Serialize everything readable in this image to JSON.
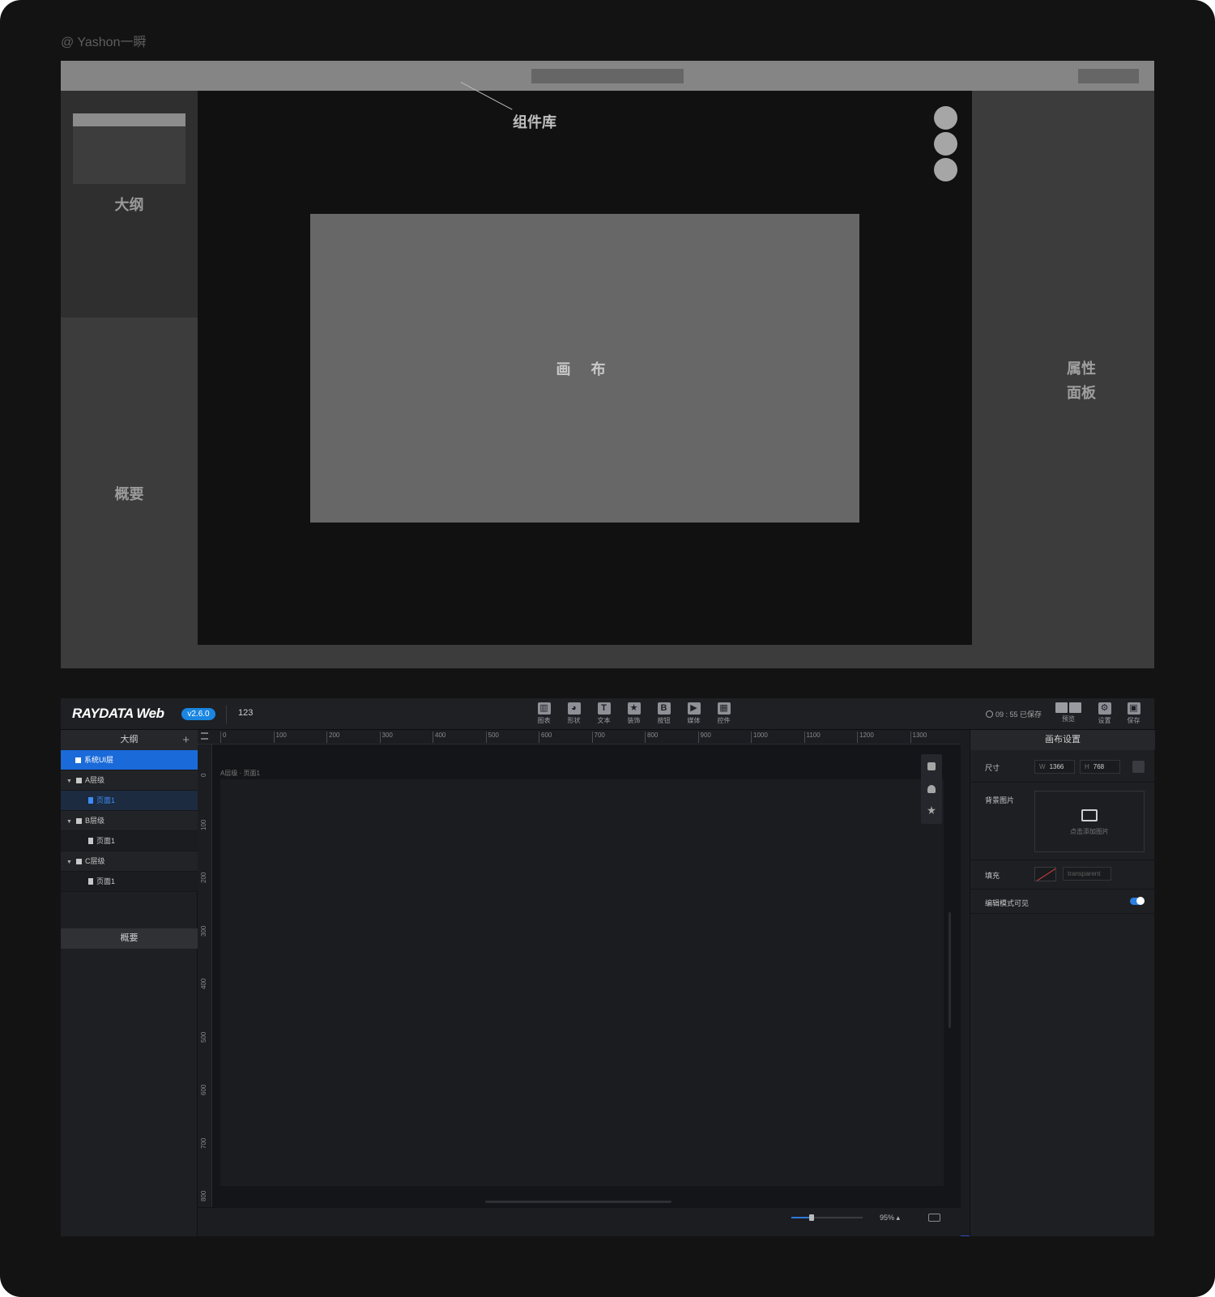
{
  "credit": "@ Yashon一瞬",
  "wireframe": {
    "outline_label": "大纲",
    "summary_label": "概要",
    "canvas_label": "画 布",
    "component_library_label": "组件库",
    "properties_label_1": "属性",
    "properties_label_2": "面板"
  },
  "app": {
    "logo": "RAYDATA Web",
    "version": "v2.6.0",
    "project_name": "123",
    "toolbar": [
      {
        "label": "图表",
        "icon": "chart-icon",
        "glyph": "▥"
      },
      {
        "label": "形状",
        "icon": "shape-icon",
        "glyph": "◕"
      },
      {
        "label": "文本",
        "icon": "text-icon",
        "glyph": "T"
      },
      {
        "label": "装饰",
        "icon": "decoration-star-icon",
        "glyph": "★"
      },
      {
        "label": "按钮",
        "icon": "button-b-icon",
        "glyph": "B"
      },
      {
        "label": "媒体",
        "icon": "media-play-icon",
        "glyph": "▶"
      },
      {
        "label": "控件",
        "icon": "widget-grid-icon",
        "glyph": "▦"
      }
    ],
    "save_status": "09 : 55 已保存",
    "preview_label": "预览",
    "settings_label": "设置",
    "save_label": "保存",
    "outline": {
      "title": "大纲",
      "add": "+",
      "system_layer": "系统UI层",
      "layers": [
        {
          "name": "A层级",
          "page": "页面1"
        },
        {
          "name": "B层级",
          "page": "页面1"
        },
        {
          "name": "C层级",
          "page": "页面1"
        }
      ]
    },
    "summary_title": "概要",
    "ruler_h": [
      "0",
      "100",
      "200",
      "300",
      "400",
      "500",
      "600",
      "700",
      "800",
      "900",
      "1000",
      "1100",
      "1200",
      "1300"
    ],
    "ruler_v": [
      "0",
      "100",
      "200",
      "300",
      "400",
      "500",
      "600",
      "700",
      "800"
    ],
    "breadcrumb": "A层级 · 页面1",
    "zoom": "95%",
    "zoom_level": 0.28,
    "panel": {
      "title": "画布设置",
      "size_label": "尺寸",
      "w_prefix": "W",
      "width": "1366",
      "h_prefix": "H",
      "height": "768",
      "bg_label": "背景图片",
      "bg_hint": "点击添加图片",
      "fill_label": "填充",
      "fill_value": "transparent",
      "edit_visible_label": "编辑模式可见",
      "edit_visible": true
    },
    "colors": {
      "accent": "#1a6ad9",
      "version_badge": "#1a86e0",
      "toggle": "#2b7fe0"
    }
  }
}
